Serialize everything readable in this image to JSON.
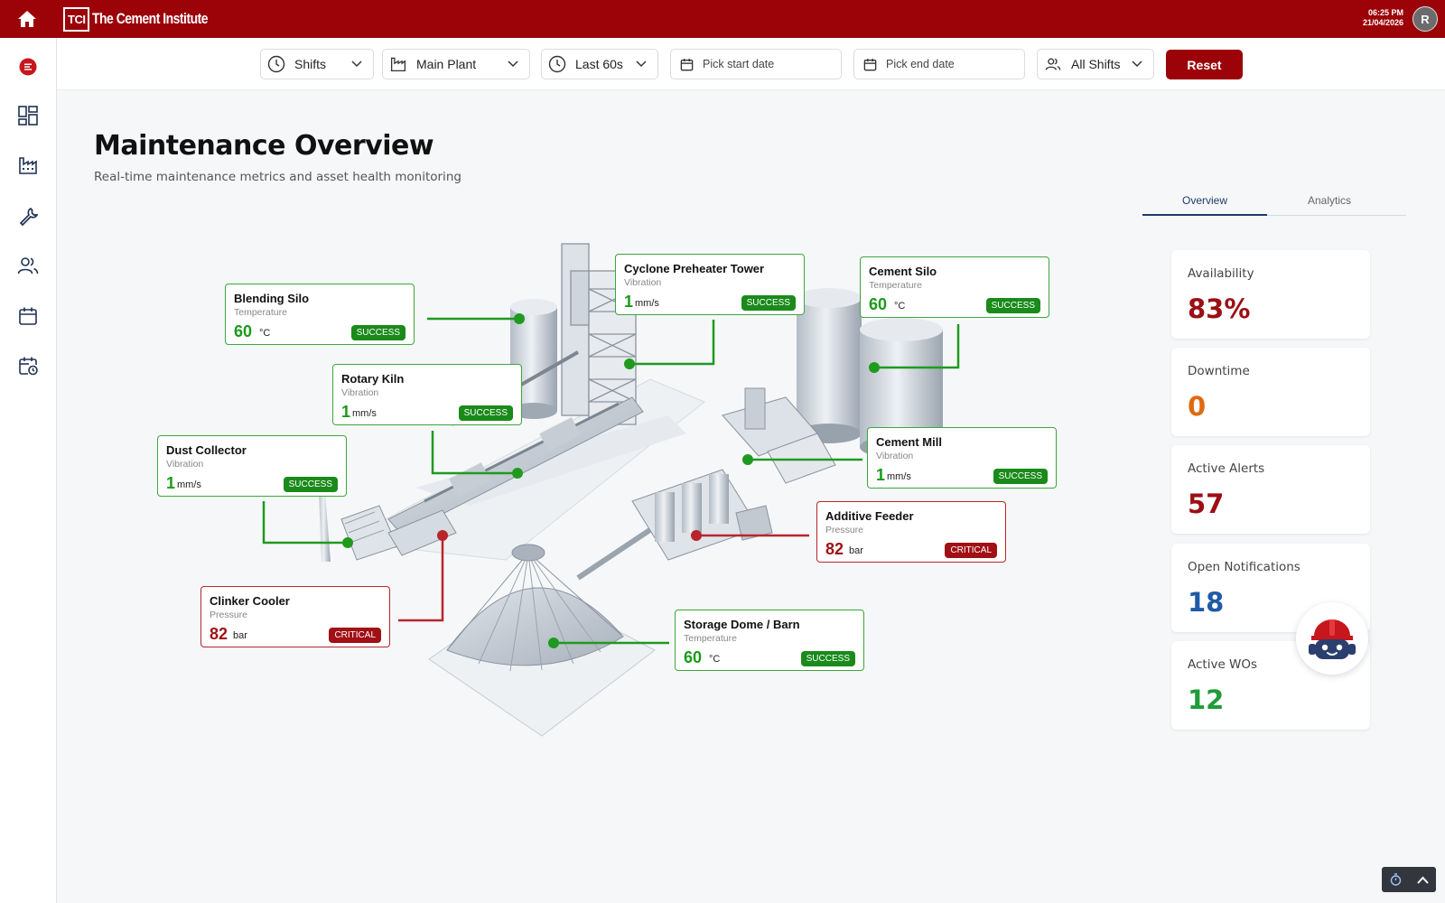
{
  "app": {
    "logo_mark": "TCI",
    "logo_text": "The Cement Institute",
    "time": "06:25 PM",
    "date": "21/04/2026",
    "user_initial": "R"
  },
  "filters": {
    "shifts": "Shifts",
    "plant": "Main Plant",
    "range": "Last 60s",
    "start_placeholder": "Pick start date",
    "end_placeholder": "Pick end date",
    "shift_group": "All Shifts",
    "reset_label": "Reset"
  },
  "page": {
    "title": "Maintenance Overview",
    "subtitle": "Real-time maintenance metrics and asset health monitoring"
  },
  "tabs": [
    {
      "label": "Overview",
      "active": true
    },
    {
      "label": "Analytics",
      "active": false
    }
  ],
  "stats": [
    {
      "label": "Availability",
      "value": "83%",
      "color": "#9b0f14"
    },
    {
      "label": "Downtime",
      "value": "0",
      "color": "#e06a10"
    },
    {
      "label": "Active Alerts",
      "value": "57",
      "color": "#9b0f14"
    },
    {
      "label": "Open Notifications",
      "value": "18",
      "color": "#1f5aa6"
    },
    {
      "label": "Active WOs",
      "value": "12",
      "color": "#1e9c3a"
    }
  ],
  "assets": [
    {
      "name": "Blending Silo",
      "metric": "Temperature",
      "value": "60",
      "unit": "°C",
      "status": "SUCCESS"
    },
    {
      "name": "Cyclone Preheater Tower",
      "metric": "Vibration",
      "value": "1",
      "unit": "mm/s",
      "status": "SUCCESS"
    },
    {
      "name": "Cement Silo",
      "metric": "Temperature",
      "value": "60",
      "unit": "°C",
      "status": "SUCCESS"
    },
    {
      "name": "Rotary Kiln",
      "metric": "Vibration",
      "value": "1",
      "unit": "mm/s",
      "status": "SUCCESS"
    },
    {
      "name": "Dust Collector",
      "metric": "Vibration",
      "value": "1",
      "unit": "mm/s",
      "status": "SUCCESS"
    },
    {
      "name": "Cement Mill",
      "metric": "Vibration",
      "value": "1",
      "unit": "mm/s",
      "status": "SUCCESS"
    },
    {
      "name": "Additive Feeder",
      "metric": "Pressure",
      "value": "82",
      "unit": "bar",
      "status": "CRITICAL"
    },
    {
      "name": "Clinker Cooler",
      "metric": "Pressure",
      "value": "82",
      "unit": "bar",
      "status": "CRITICAL"
    },
    {
      "name": "Storage Dome / Barn",
      "metric": "Temperature",
      "value": "60",
      "unit": "°C",
      "status": "SUCCESS"
    }
  ],
  "colors": {
    "brand": "#9b0308",
    "success": "#1a8a1a",
    "critical": "#a01015"
  }
}
